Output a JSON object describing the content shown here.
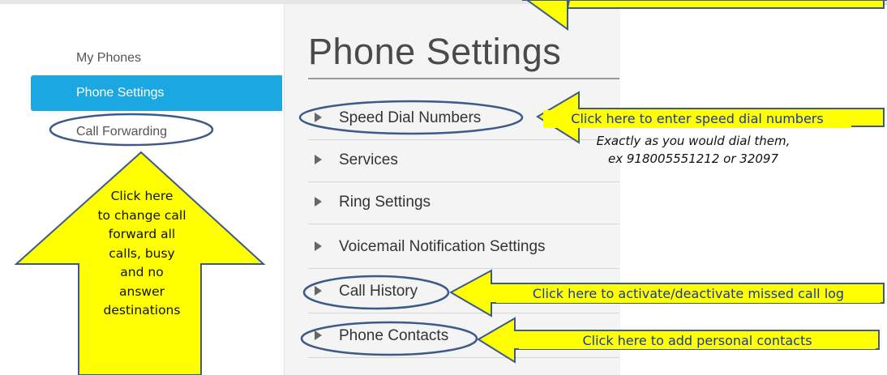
{
  "sidebar": {
    "items": [
      {
        "label": "My Phones"
      },
      {
        "label": "Phone Settings"
      },
      {
        "label": "Call Forwarding"
      }
    ]
  },
  "main": {
    "title": "Phone Settings",
    "rows": [
      {
        "label": "Speed Dial Numbers"
      },
      {
        "label": "Services"
      },
      {
        "label": "Ring Settings"
      },
      {
        "label": "Voicemail Notification Settings"
      },
      {
        "label": "Call History"
      },
      {
        "label": "Phone Contacts"
      }
    ]
  },
  "annotations": {
    "speed_dial": "Click here to enter speed dial numbers",
    "speed_dial_note_1": "Exactly as you would dial them,",
    "speed_dial_note_2": "ex 918005551212 or 32097",
    "call_forward": [
      "Click here",
      "to change call",
      "forward all",
      "calls, busy",
      "and no",
      "answer",
      "destinations"
    ],
    "call_history": "Click here to activate/deactivate missed call log",
    "phone_contacts": "Click here to add personal contacts"
  },
  "colors": {
    "accent": "#1ba7e1",
    "callout_fill": "#ffff00",
    "oval_stroke": "#3c5a8a"
  }
}
